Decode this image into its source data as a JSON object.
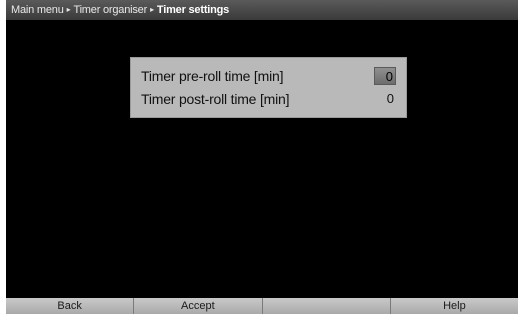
{
  "breadcrumb": {
    "items": [
      "Main menu",
      "Timer organiser"
    ],
    "current": "Timer settings",
    "separator": "▸"
  },
  "settings": {
    "rows": [
      {
        "label": "Timer pre-roll time [min]",
        "value": "0",
        "selected": true
      },
      {
        "label": "Timer post-roll time [min]",
        "value": "0",
        "selected": false
      }
    ]
  },
  "softkeys": {
    "back": "Back",
    "accept": "Accept",
    "empty": "",
    "help": "Help"
  },
  "colors": {
    "screen_background": "#000000",
    "dialog_background": "#b9b9b9",
    "softkey_background": "#b9b9b9"
  }
}
